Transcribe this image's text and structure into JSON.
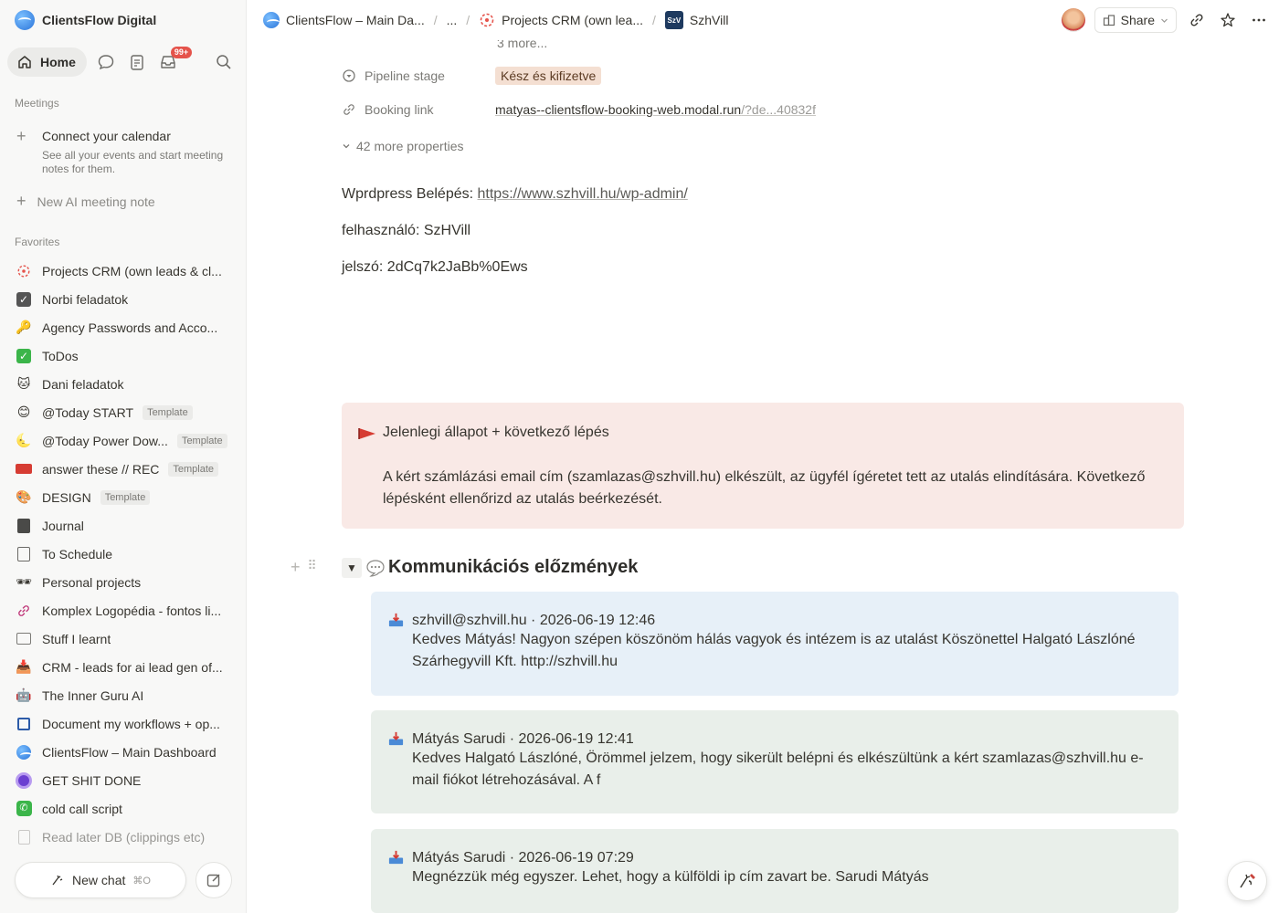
{
  "sidebar": {
    "workspace": "ClientsFlow Digital",
    "home_label": "Home",
    "inbox_badge": "99+",
    "meetings_label": "Meetings",
    "connect_title": "Connect your calendar",
    "connect_sub": "See all your events and start meeting notes for them.",
    "new_ai_note": "New AI meeting note",
    "favorites_label": "Favorites",
    "favorites": [
      {
        "label": "Projects CRM (own leads & cl...",
        "icon": "crm-icon",
        "template": ""
      },
      {
        "label": "Norbi feladatok",
        "icon": "checkbox-icon",
        "template": ""
      },
      {
        "label": "Agency Passwords and Acco...",
        "icon": "key-icon",
        "template": ""
      },
      {
        "label": "ToDos",
        "icon": "check-icon",
        "template": ""
      },
      {
        "label": "Dani feladatok",
        "icon": "cat-icon",
        "template": ""
      },
      {
        "label": "@Today START",
        "icon": "smile-icon",
        "template": "Template"
      },
      {
        "label": "@Today Power Dow...",
        "icon": "moon-icon",
        "template": "Template"
      },
      {
        "label": "answer these // REC",
        "icon": "video-icon",
        "template": "Template"
      },
      {
        "label": "DESIGN",
        "icon": "palette-icon",
        "template": "Template"
      },
      {
        "label": "Journal",
        "icon": "journal-icon",
        "template": ""
      },
      {
        "label": "To Schedule",
        "icon": "list-icon",
        "template": ""
      },
      {
        "label": "Personal projects",
        "icon": "sunglasses-icon",
        "template": ""
      },
      {
        "label": "Komplex Logopédia - fontos li...",
        "icon": "link-icon",
        "template": ""
      },
      {
        "label": "Stuff I learnt",
        "icon": "table-icon",
        "template": ""
      },
      {
        "label": "CRM - leads for ai lead gen of...",
        "icon": "inbox-icon",
        "template": ""
      },
      {
        "label": "The Inner Guru AI",
        "icon": "robot-icon",
        "template": ""
      },
      {
        "label": "Document my workflows + op...",
        "icon": "chip-icon",
        "template": ""
      },
      {
        "label": "ClientsFlow – Main Dashboard",
        "icon": "globe-icon",
        "template": ""
      },
      {
        "label": "GET SHIT DONE",
        "icon": "target-icon",
        "template": ""
      },
      {
        "label": "cold call script",
        "icon": "phone-icon",
        "template": ""
      },
      {
        "label": "Read later DB (clippings etc)",
        "icon": "doc-icon",
        "template": ""
      }
    ],
    "new_chat": "New chat",
    "new_chat_kbd": "⌘O"
  },
  "topbar": {
    "crumb1": "ClientsFlow – Main Da...",
    "crumb2": "...",
    "crumb3": "Projects CRM (own lea...",
    "crumb4": "SzhVill",
    "share": "Share"
  },
  "page": {
    "more_small": "3 more...",
    "pipeline_label": "Pipeline stage",
    "pipeline_value": "Kész és kifizetve",
    "booking_label": "Booking link",
    "booking_main": "matyas--clientsflow-booking-web.modal.run",
    "booking_dim": "/?de...40832f",
    "more_props": "42 more properties",
    "wp_label": "Wprdpress Belépés: ",
    "wp_url": "https://www.szhvill.hu/wp-admin/",
    "user_line": "felhasználó: SzHVill",
    "pass_line": "jelszó: 2dCq7k2JaBb%0Ews",
    "callout_title": "Jelenlegi állapot + következő lépés",
    "callout_body": "A kért számlázási email cím (szamlazas@szhvill.hu) elkészült, az ügyfél ígéretet tett az utalás elindítására. Következő lépésként ellenőrizd az utalás beérkezését.",
    "section_title": "Kommunikációs előzmények",
    "messages": [
      {
        "header": "szhvill@szhvill.hu · 2026-06-19 12:46",
        "body": "Kedves Mátyás! Nagyon szépen köszönöm hálás vagyok és intézem is az utalást Köszönettel Halgató Lászlóné Szárhegyvill Kft. http://szhvill.hu"
      },
      {
        "header": "Mátyás Sarudi · 2026-06-19 12:41",
        "body": "Kedves Halgató Lászlóné, Örömmel jelzem, hogy sikerült belépni és elkészültünk a kért szamlazas@szhvill.hu e-mail fiókot létrehozásával. A f"
      },
      {
        "header": "Mátyás Sarudi · 2026-06-19 07:29",
        "body": "Megnézzük még egyszer. Lehet, hogy a külföldi ip cím zavart be. Sarudi Mátyás"
      }
    ]
  }
}
